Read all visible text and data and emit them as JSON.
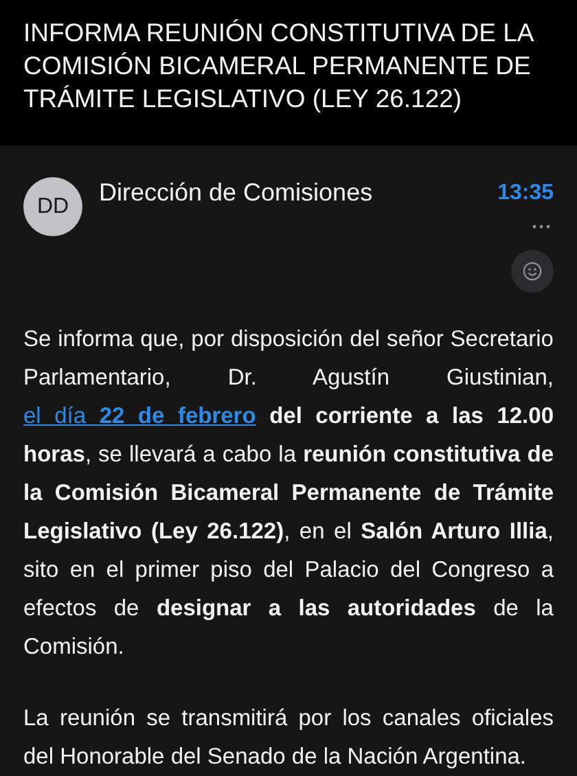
{
  "subject": "INFORMA REUNIÓN CONSTITUTIVA DE LA COMISIÓN BICAMERAL PERMANENTE DE TRÁMITE LEGISLATIVO (LEY 26.122)",
  "message": {
    "avatar_initials": "DD",
    "sender": "Dirección de Comisiones",
    "time": "13:35",
    "paragraphs": [
      {
        "parts": [
          {
            "kind": "text",
            "text": "Se informa que, por disposición del señor Secretario Parlamentario, Dr. Agustín Giustinian, "
          },
          {
            "kind": "link",
            "text": "el día **22 de febrero**"
          },
          {
            "kind": "text",
            "text": " **del corriente a las 12.00 horas**, se llevará a cabo la **reunión constitutiva de la Comisión Bicameral Permanente de Trámite Legislativo (Ley 26.122)**, en el **Salón Arturo Illia**, sito en el primer piso del Palacio del Congreso a efectos de **designar a las autoridades** de la Comisión."
          }
        ]
      },
      {
        "parts": [
          {
            "kind": "text",
            "text": "La reunión se transmitirá por los canales oficiales del Honorable del Senado de la Nación Argentina."
          }
        ]
      }
    ]
  }
}
